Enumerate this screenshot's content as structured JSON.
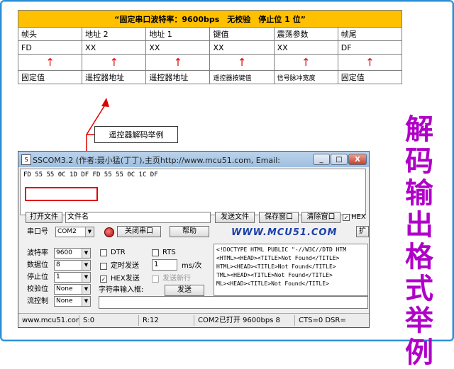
{
  "table": {
    "title": "“固定串口波特率：9600bps　无校验　停止位 1 位”",
    "headers": [
      "帧头",
      "地址 2",
      "地址 1",
      "键值",
      "震荡参数",
      "帧尾"
    ],
    "values": [
      "FD",
      "XX",
      "XX",
      "XX",
      "XX",
      "DF"
    ],
    "arrows": [
      "↑",
      "↑",
      "↑",
      "↑",
      "↑",
      "↑"
    ],
    "descriptions": [
      "固定值",
      "遥控器地址",
      "遥控器地址",
      "遥控器按键值",
      "信号脉冲宽度",
      "固定值"
    ]
  },
  "callout": "遥控器解码举例",
  "side_title": [
    "解",
    "码",
    "输",
    "出",
    "格",
    "式",
    "举",
    "例"
  ],
  "window": {
    "title": "SSCOM3.2 (作者:聂小猛(丁丁),主页http://www.mcu51.com, Email:",
    "minimize": "_",
    "maximize": "□",
    "close": "X",
    "receive_text": "FD 55 55 0C 1D DF FD 55 55 0C 1C DF",
    "open_file_button": "打开文件",
    "file_name_field": "文件名",
    "send_file_button": "发送文件",
    "save_window_button": "保存窗口",
    "clear_window_button": "清除窗口",
    "hex_display_label": "HEX",
    "port_label": "串口号",
    "port_value": "COM2",
    "close_port_button": "关闭串口",
    "help_button": "帮助",
    "brand": "WWW.MCU51.COM",
    "expand_button": "扩",
    "baud_label": "波特率",
    "baud_value": "9600",
    "databits_label": "数据位",
    "databits_value": "8",
    "stopbits_label": "停止位",
    "stopbits_value": "1",
    "parity_label": "校验位",
    "parity_value": "None",
    "flow_label": "流控制",
    "flow_value": "None",
    "dtr_label": "DTR",
    "rts_label": "RTS",
    "timed_send_label": "定时发送",
    "interval_value": "1",
    "interval_unit": "ms/次",
    "hex_send_label": "HEX发送",
    "send_newline_label": "发送新行",
    "input_label": "字符串输入框:",
    "send_button": "发送",
    "html_lines": [
      "<!DOCTYPE HTML PUBLIC \"-//W3C//DTD HTM",
      "<HTML><HEAD><TITLE>Not Found</TITLE>",
      "HTML><HEAD><TITLE>Not Found</TITLE>",
      "TML><HEAD><TITLE>Not Found</TITLE>",
      "ML><HEAD><TITLE>Not Found</TITLE>"
    ],
    "status": {
      "site": "www.mcu51.cor",
      "sent": "S:0",
      "received": "R:12",
      "port_state": "COM2已打开  9600bps  8",
      "cts": "CTS=0 DSR="
    }
  }
}
